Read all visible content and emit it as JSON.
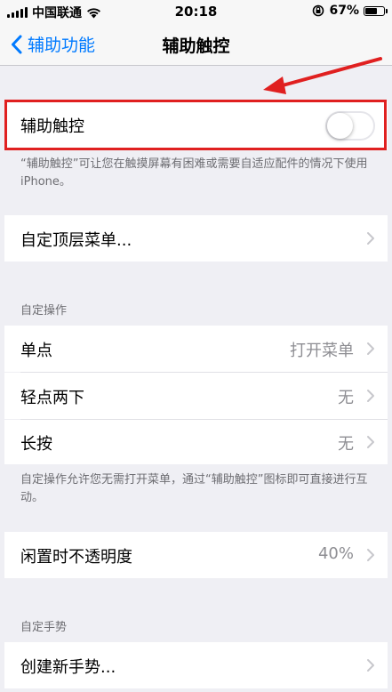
{
  "status_bar": {
    "carrier": "中国联通",
    "time": "20:18",
    "battery_percent": "67%",
    "battery_level": 0.67
  },
  "nav": {
    "back_label": "辅助功能",
    "title": "辅助触控"
  },
  "assistive_touch": {
    "label": "辅助触控",
    "enabled": false,
    "description": "“辅助触控”可让您在触摸屏幕有困难或需要自适应配件的情况下使用 iPhone。"
  },
  "customize_top_menu": {
    "label": "自定顶层菜单..."
  },
  "custom_actions": {
    "header": "自定操作",
    "items": [
      {
        "label": "单点",
        "value": "打开菜单"
      },
      {
        "label": "轻点两下",
        "value": "无"
      },
      {
        "label": "长按",
        "value": "无"
      }
    ],
    "footer": "自定操作允许您无需打开菜单，通过“辅助触控”图标即可直接进行互动。"
  },
  "idle_opacity": {
    "label": "闲置时不透明度",
    "value": "40%"
  },
  "custom_gestures": {
    "header": "自定手势",
    "create_label": "创建新手势..."
  },
  "colors": {
    "accent": "#007aff",
    "highlight": "#e02020"
  }
}
